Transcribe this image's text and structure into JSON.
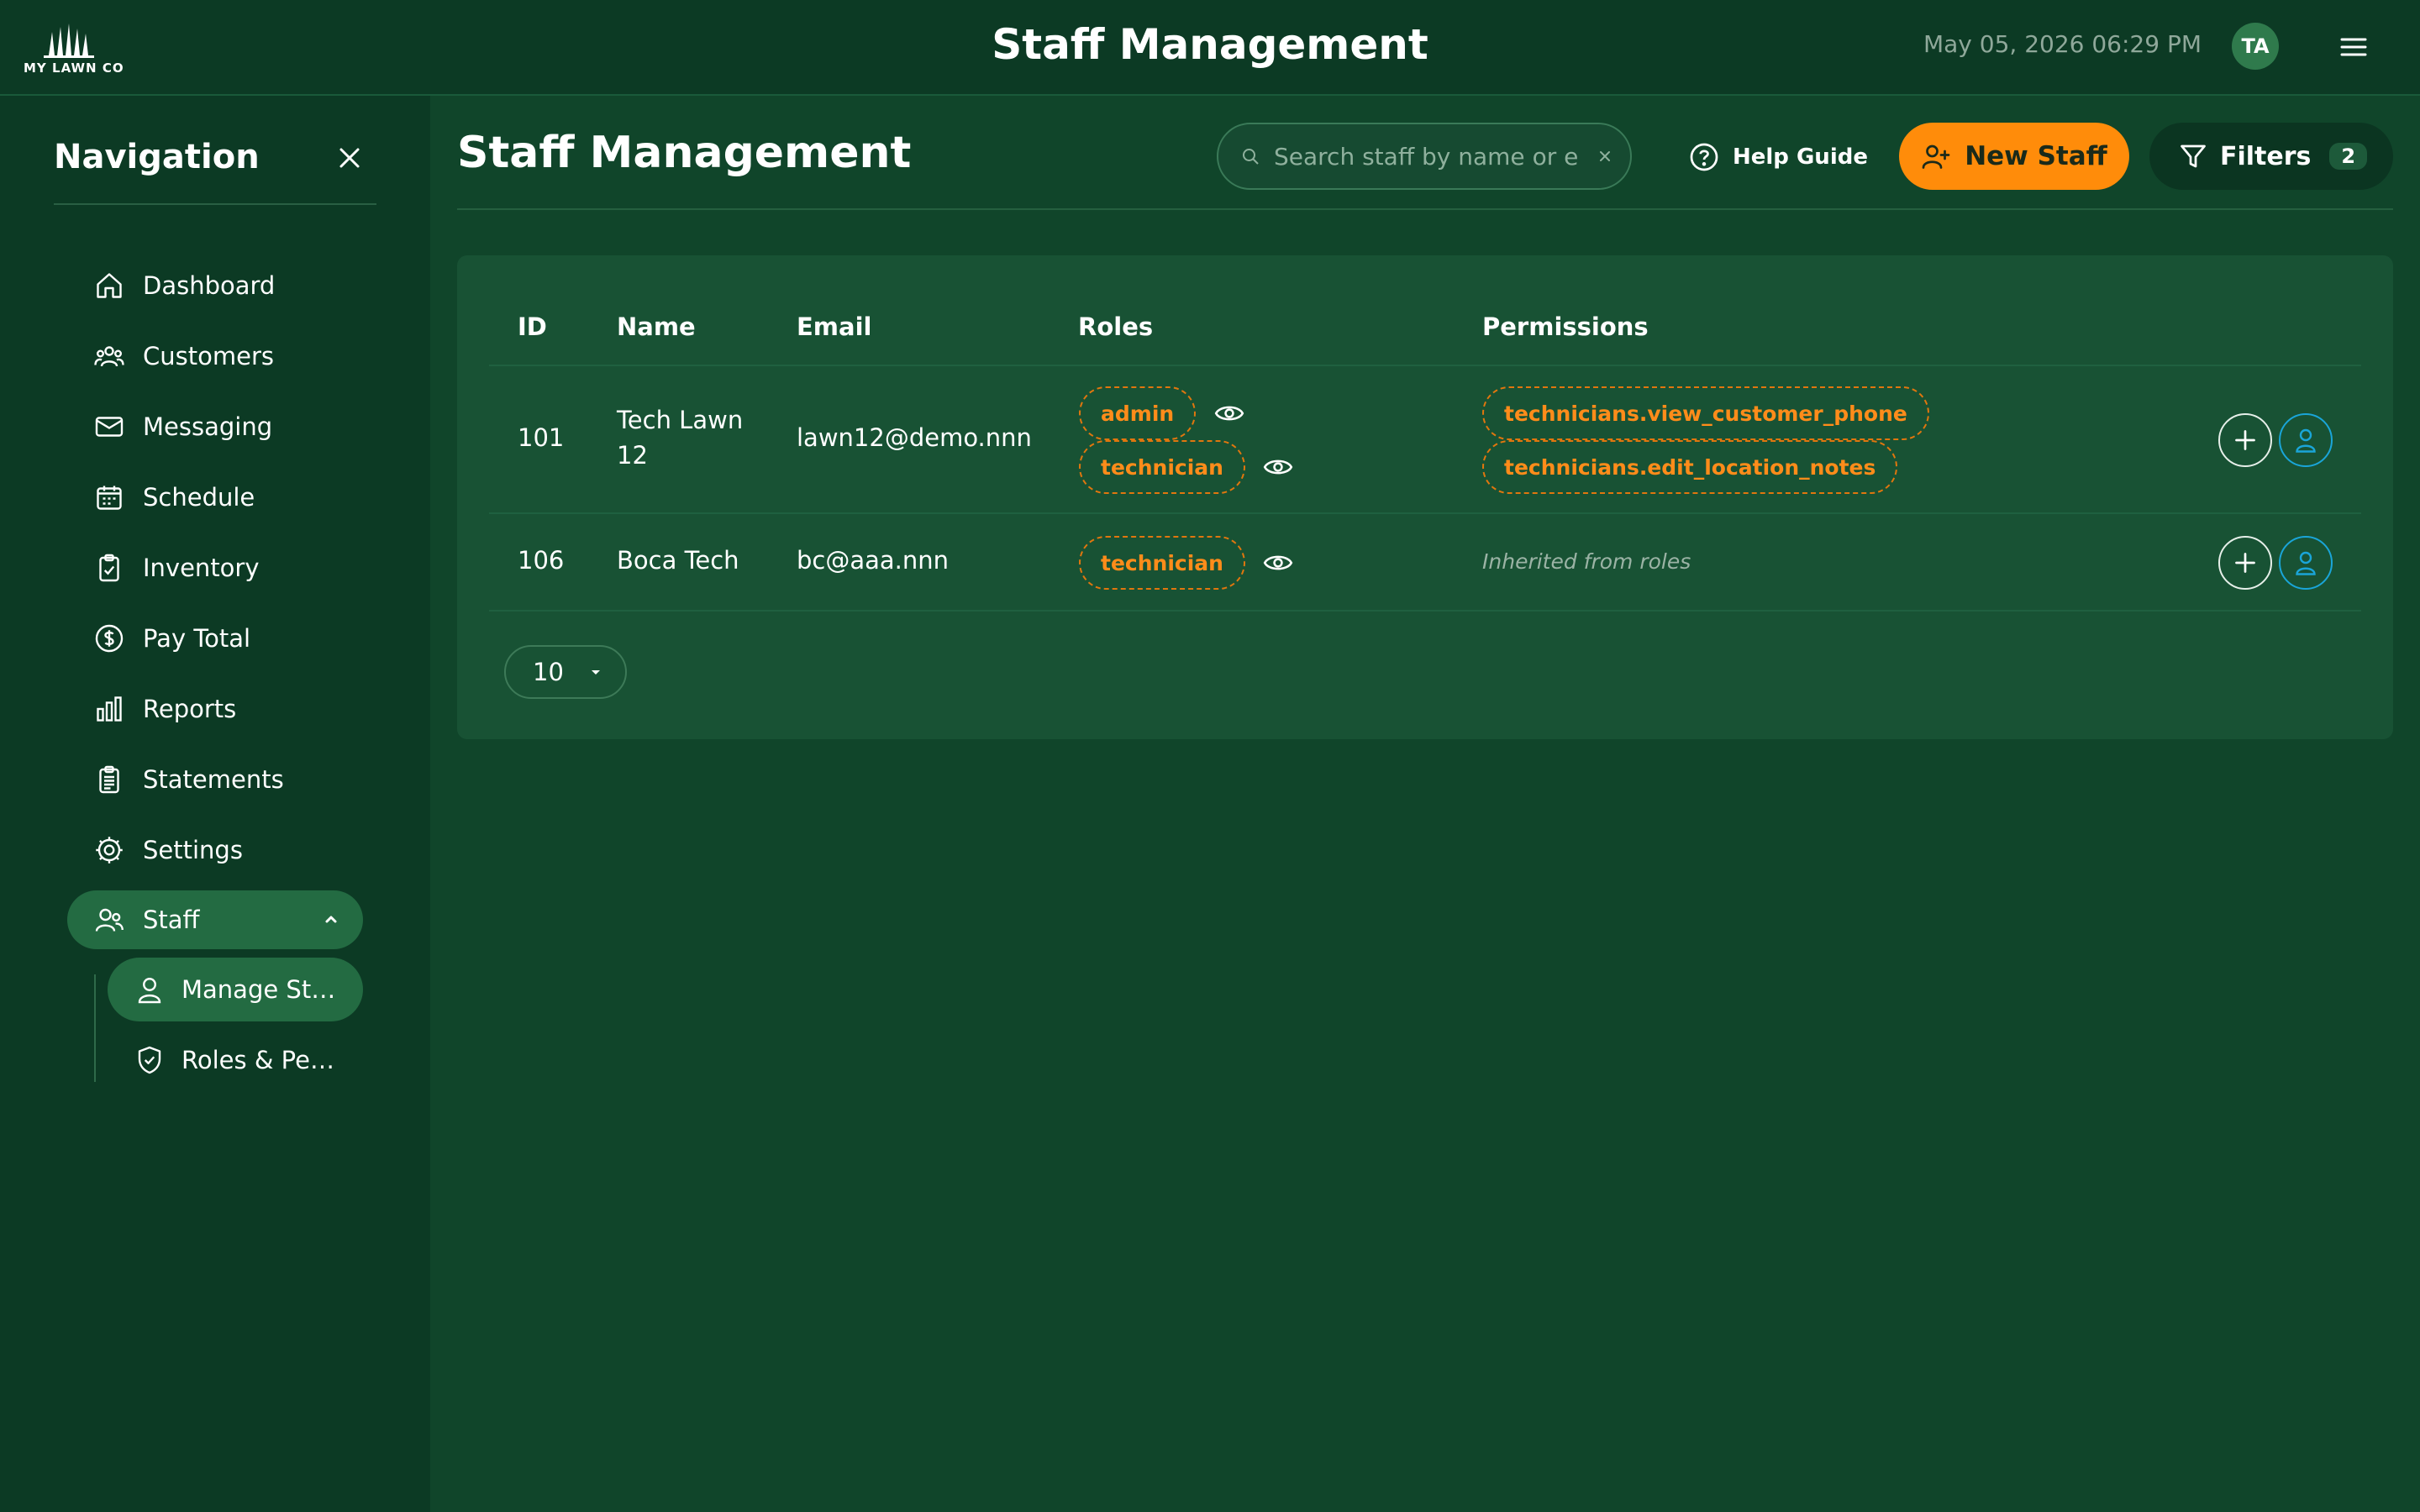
{
  "app": {
    "logo_text": "MY LAWN CO",
    "title": "Staff Management",
    "datetime": "May 05, 2026 06:29 PM",
    "user_initials": "TA"
  },
  "sidebar": {
    "title": "Navigation",
    "items": [
      {
        "label": "Dashboard",
        "icon": "home-icon"
      },
      {
        "label": "Customers",
        "icon": "users-group-icon"
      },
      {
        "label": "Messaging",
        "icon": "mail-icon"
      },
      {
        "label": "Schedule",
        "icon": "calendar-icon"
      },
      {
        "label": "Inventory",
        "icon": "clipboard-check-icon"
      },
      {
        "label": "Pay Total",
        "icon": "dollar-circle-icon"
      },
      {
        "label": "Reports",
        "icon": "bar-chart-icon"
      },
      {
        "label": "Statements",
        "icon": "statement-icon"
      },
      {
        "label": "Settings",
        "icon": "gear-icon"
      },
      {
        "label": "Staff",
        "icon": "staff-icon",
        "expanded": true
      }
    ],
    "subitems": [
      {
        "label": "Manage St…",
        "icon": "person-icon",
        "active": true
      },
      {
        "label": "Roles & Pe…",
        "icon": "shield-check-icon"
      }
    ]
  },
  "main": {
    "title": "Staff Management",
    "search_placeholder": "Search staff by name or e",
    "help_label": "Help Guide",
    "new_staff_label": "New Staff",
    "filters_label": "Filters",
    "filters_count": "2",
    "table": {
      "headers": [
        "ID",
        "Name",
        "Email",
        "Roles",
        "Permissions"
      ],
      "rows": [
        {
          "id": "101",
          "name": "Tech Lawn 12",
          "email": "lawn12@demo.nnn",
          "roles": [
            "admin",
            "technician"
          ],
          "permissions": [
            "technicians.view_customer_phone",
            "technicians.edit_location_notes"
          ]
        },
        {
          "id": "106",
          "name": "Boca Tech",
          "email": "bc@aaa.nnn",
          "roles": [
            "technician"
          ],
          "permissions_note": "Inherited from roles"
        }
      ]
    },
    "page_size": "10"
  },
  "colors": {
    "background": "#10452a",
    "sidebar": "#0c3a24",
    "card": "#185234",
    "accent_orange": "#ff8c0a",
    "active_nav": "#236b42",
    "user_action_blue": "#1aa5d8"
  }
}
